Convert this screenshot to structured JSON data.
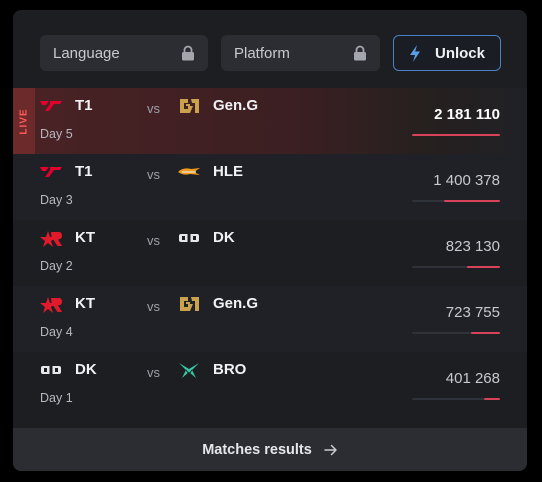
{
  "filters": {
    "language": {
      "label": "Language",
      "icon": "lock-icon"
    },
    "platform": {
      "label": "Platform",
      "icon": "lock-icon"
    }
  },
  "unlock": {
    "label": "Unlock",
    "icon": "lightning-icon",
    "border_color": "#4d7fc4"
  },
  "live_label": "LIVE",
  "vs_label": "vs",
  "matches": [
    {
      "team1": "T1",
      "team1_logo": "t1-logo",
      "team2": "Gen.G",
      "team2_logo": "geng-logo",
      "day": "Day 5",
      "views": "2 181 110",
      "share": 1.0,
      "live": true
    },
    {
      "team1": "T1",
      "team1_logo": "t1-logo",
      "team2": "HLE",
      "team2_logo": "hle-logo",
      "day": "Day 3",
      "views": "1 400 378",
      "share": 0.64,
      "live": false
    },
    {
      "team1": "KT",
      "team1_logo": "kt-logo",
      "team2": "DK",
      "team2_logo": "dk-logo",
      "day": "Day 2",
      "views": "823 130",
      "share": 0.38,
      "live": false
    },
    {
      "team1": "KT",
      "team1_logo": "kt-logo",
      "team2": "Gen.G",
      "team2_logo": "geng-logo",
      "day": "Day 4",
      "views": "723 755",
      "share": 0.33,
      "live": false
    },
    {
      "team1": "DK",
      "team1_logo": "dk-logo",
      "team2": "BRO",
      "team2_logo": "bro-logo",
      "day": "Day 1",
      "views": "401 268",
      "share": 0.18,
      "live": false
    }
  ],
  "colors": {
    "accent": "#d9435a",
    "live_text": "#ff5a5a",
    "card_bg": "#1d1e22"
  },
  "footer": {
    "label": "Matches results",
    "icon": "arrow-right-icon"
  }
}
